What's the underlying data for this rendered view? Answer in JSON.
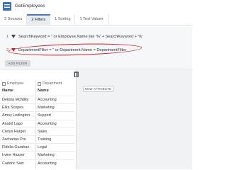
{
  "window": {
    "title": "GetEmployees"
  },
  "tabs": [
    {
      "label": "2 Sources"
    },
    {
      "label": "2 Filters"
    },
    {
      "label": "1 Sorting"
    },
    {
      "label": "1 Test Values"
    }
  ],
  "filters": [
    {
      "index": "1",
      "expression": "SearchKeyword = '' or Employee.Name like '%' + SearchKeyword + '%'"
    },
    {
      "index": "2",
      "expression": "DepartmentFilter = '' or Department.Name = DepartmentFilter"
    }
  ],
  "add_filter_label": "ADD FILTER",
  "new_attribute_label": "NEW ATTRIBUTE",
  "table": {
    "groups": [
      "Employee",
      "Department"
    ],
    "columns": [
      "Name",
      "Name"
    ],
    "rows": [
      [
        "Deloria McNility",
        "Accounting"
      ],
      [
        "Elka Scopes",
        "Marketing"
      ],
      [
        "Amny Ledington",
        "Support"
      ],
      [
        "Anatol Lago",
        "Accounting"
      ],
      [
        "Cletus Harget",
        "Sales"
      ],
      [
        "Zacharias Pre",
        "Training"
      ],
      [
        "Fidelia Garahan",
        "Legal"
      ],
      [
        "Irvine Hasser",
        "Marketing"
      ],
      [
        "Caddric Saiz",
        "Accounting"
      ]
    ]
  },
  "colors": {
    "accent": "#4a78b5",
    "annotation": "#d21f2a"
  }
}
